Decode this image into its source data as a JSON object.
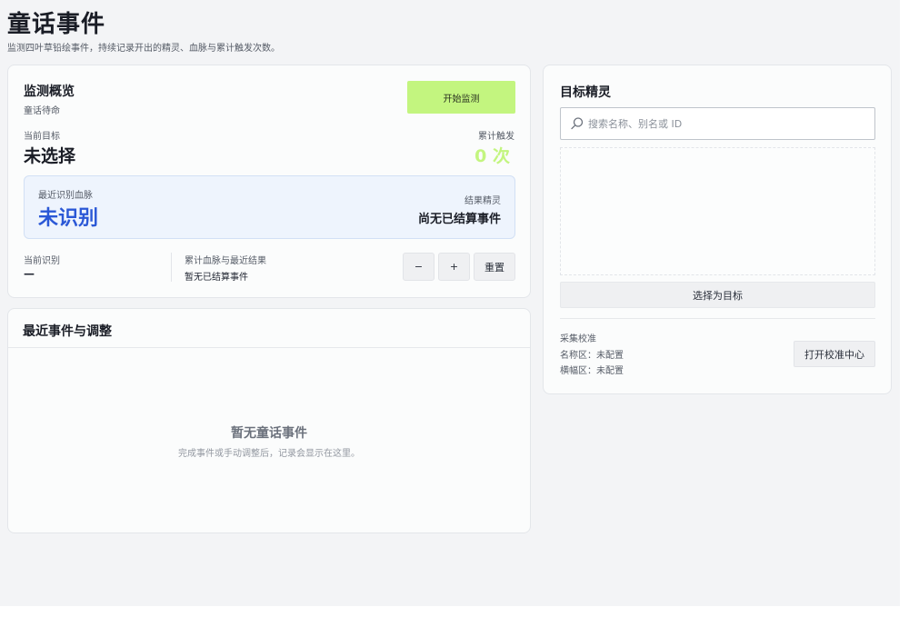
{
  "page": {
    "title": "童话事件",
    "subtitle": "监测四叶草铅绘事件，持续记录开出的精灵、血脉与累计触发次数。"
  },
  "monitor": {
    "title": "监测概览",
    "status": "童话待命",
    "start_button": "开始监测",
    "current_target_label": "当前目标",
    "current_target_value": "未选择",
    "trigger_count_label": "累计触发",
    "trigger_count_value": "0 次",
    "lineage_label": "最近识别血脉",
    "lineage_value": "未识别",
    "settle_label": "结果精灵",
    "settle_value": "尚无已结算事件",
    "current_recog_label": "当前识别",
    "current_recog_value": "—",
    "cumulative_label": "累计血脉与最近结果",
    "cumulative_value": "暂无已结算事件",
    "minus_button": "−",
    "plus_button": "+",
    "reset_button": "重置"
  },
  "events": {
    "title": "最近事件与调整",
    "empty_title": "暂无童话事件",
    "empty_desc": "完成事件或手动调整后，记录会显示在这里。"
  },
  "target": {
    "title": "目标精灵",
    "search_placeholder": "搜索名称、别名或 ID",
    "select_button": "选择为目标",
    "calib_title": "采集校准",
    "name_area": "名称区：未配置",
    "banner_area": "横幅区：未配置",
    "calib_button": "打开校准中心"
  },
  "colors": {
    "accent_green": "#c3f57f",
    "accent_blue": "#2b58d6",
    "lineage_bg": "#eef4fd"
  }
}
